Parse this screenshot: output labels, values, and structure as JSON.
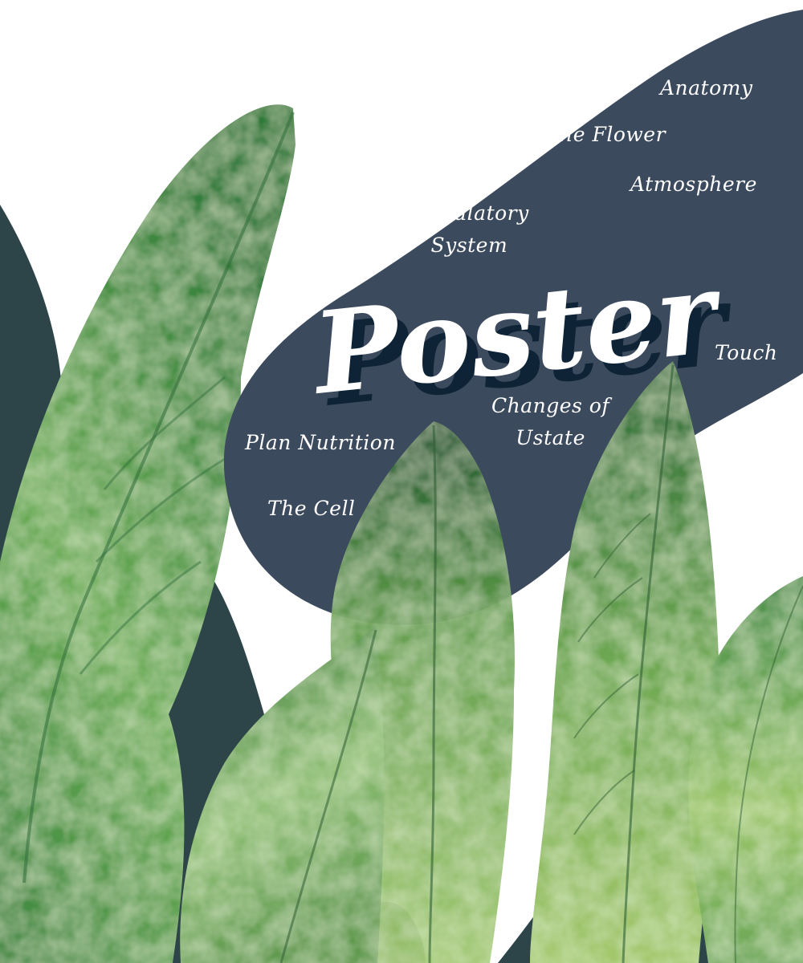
{
  "title": "Poster",
  "topics": {
    "anatomy": "Anatomy",
    "the_flower": "The Flower",
    "atmosphere": "Atmosphere",
    "circulatory": [
      "Circulatory",
      "System"
    ],
    "touch": "Touch",
    "changes": [
      "Changes of",
      "Ustate"
    ],
    "plan_nutrition": "Plan Nutrition",
    "the_cell": "The Cell"
  },
  "colors": {
    "background": "#ffffff",
    "navy_blob": "#3c4a5e",
    "dark_teal": "#2d4549",
    "title_shadow": "#0e2436",
    "leaf_dark": "#2f6d3a",
    "leaf_mid": "#4e9447",
    "leaf_light": "#9cc66a"
  }
}
